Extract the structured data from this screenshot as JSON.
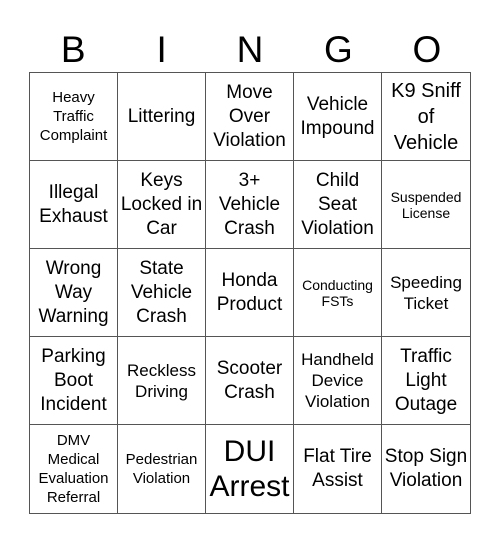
{
  "header": {
    "letters": [
      "B",
      "I",
      "N",
      "G",
      "O"
    ]
  },
  "cells": [
    {
      "text": "Heavy Traffic Complaint",
      "size": "s"
    },
    {
      "text": "Littering",
      "size": "m"
    },
    {
      "text": "Move Over Violation",
      "size": "m"
    },
    {
      "text": "Vehicle Impound",
      "size": "m"
    },
    {
      "text": "K9 Sniff of Vehicle",
      "size": "l"
    },
    {
      "text": "Illegal Exhaust",
      "size": "m"
    },
    {
      "text": "Keys Locked in Car",
      "size": "m"
    },
    {
      "text": "3+ Vehicle Crash",
      "size": "m"
    },
    {
      "text": "Child Seat Violation",
      "size": "m"
    },
    {
      "text": "Suspended License",
      "size": "xs"
    },
    {
      "text": "Wrong Way Warning",
      "size": "m"
    },
    {
      "text": "State Vehicle Crash",
      "size": "m"
    },
    {
      "text": "Honda Product",
      "size": "m"
    },
    {
      "text": "Conducting FSTs",
      "size": "xs"
    },
    {
      "text": "Speeding Ticket",
      "size": "sm"
    },
    {
      "text": "Parking Boot Incident",
      "size": "m"
    },
    {
      "text": "Reckless Driving",
      "size": "sm"
    },
    {
      "text": "Scooter Crash",
      "size": "m"
    },
    {
      "text": "Handheld Device Violation",
      "size": "sm"
    },
    {
      "text": "Traffic Light Outage",
      "size": "m"
    },
    {
      "text": "DMV Medical Evaluation Referral",
      "size": "s"
    },
    {
      "text": "Pedestrian Violation",
      "size": "s"
    },
    {
      "text": "DUI Arrest",
      "size": "xl"
    },
    {
      "text": "Flat Tire Assist",
      "size": "m"
    },
    {
      "text": "Stop Sign Violation",
      "size": "m"
    }
  ]
}
